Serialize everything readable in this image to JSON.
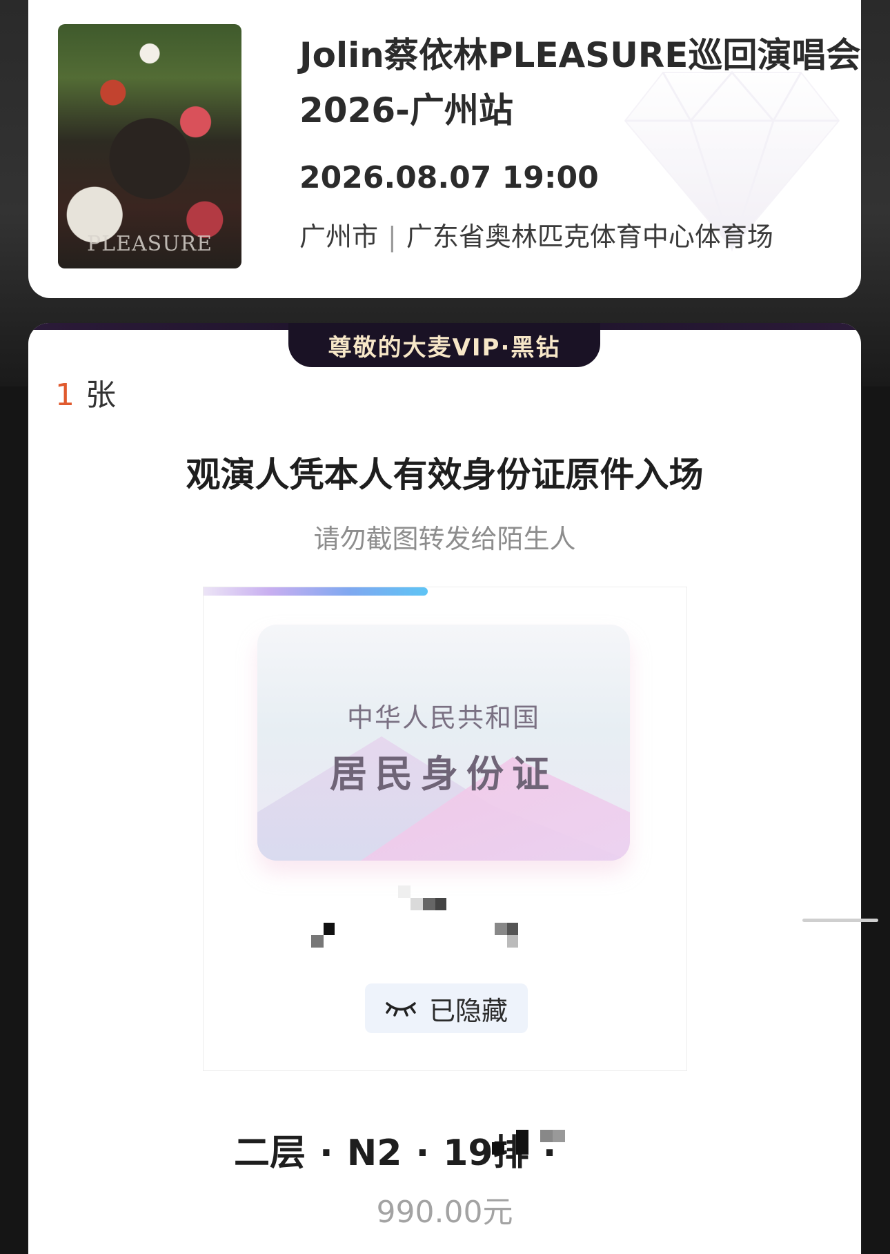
{
  "event": {
    "title": "Jolin蔡依林PLEASURE巡回演唱会2026-广州站",
    "datetime": "2026.08.07 19:00",
    "city": "广州市",
    "separator": "|",
    "venue": "广东省奥林匹克体育中心体育场",
    "poster_text": "PLEASURE"
  },
  "ticket": {
    "vip_banner": "尊敬的大麦VIP·黑钻",
    "quantity": "1",
    "quantity_unit": "张",
    "notice_main": "观演人凭本人有效身份证原件入场",
    "notice_sub": "请勿截图转发给陌生人",
    "id_card": {
      "country": "中华人民共和国",
      "type": "居民身份证"
    },
    "hidden_label": "已隐藏",
    "seat": {
      "floor": "二层",
      "section": "N2",
      "row": "19排",
      "dot": "·"
    },
    "price": "990.00元"
  },
  "colors": {
    "accent_quantity": "#e05a2e",
    "vip_banner_bg": "#1a1225",
    "vip_banner_text": "#f7e7c8"
  }
}
